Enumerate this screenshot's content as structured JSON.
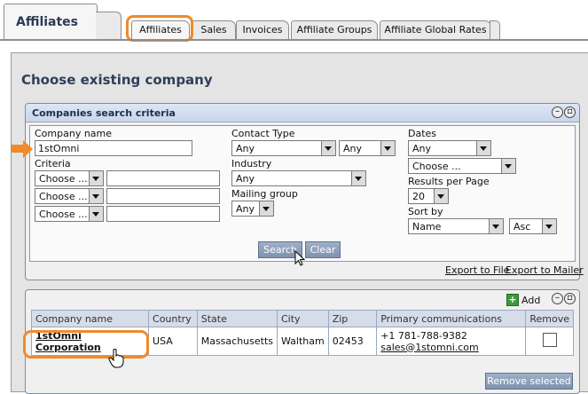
{
  "tabs": {
    "main": "Affiliates",
    "sub": [
      "Affiliates",
      "Sales",
      "Invoices",
      "Affiliate Groups",
      "Affiliate Global Rates"
    ]
  },
  "page_title": "Choose existing company",
  "search_panel": {
    "title": "Companies search criteria",
    "company_name_label": "Company name",
    "company_name_value": "1stOmni",
    "criteria_label": "Criteria",
    "criteria_select": "Choose ...",
    "contact_type_label": "Contact Type",
    "contact_type_value": "Any",
    "contact_type_value2": "Any",
    "industry_label": "Industry",
    "industry_value": "Any",
    "mailing_group_label": "Mailing group",
    "mailing_group_value": "Any",
    "dates_label": "Dates",
    "dates_value": "Any",
    "dates_choose": "Choose ...",
    "results_per_page_label": "Results per Page",
    "results_per_page_value": "20",
    "sort_by_label": "Sort by",
    "sort_by_value": "Name",
    "sort_order_value": "Asc",
    "search_button": "Search",
    "clear_button": "Clear",
    "export_file": "Export to File",
    "export_mailer": "Export to Mailer"
  },
  "results_panel": {
    "add_label": "Add",
    "columns": [
      "Company name",
      "Country",
      "State",
      "City",
      "Zip",
      "Primary communications",
      "Remove"
    ],
    "rows": [
      {
        "company": "1stOmni Corporation",
        "country": "USA",
        "state": "Massachusetts",
        "city": "Waltham",
        "zip": "02453",
        "phone": "+1 781-788-9382",
        "email": "sales@1stomni.com"
      }
    ],
    "remove_selected": "Remove selected"
  },
  "colors": {
    "highlight": "#f08a2c",
    "panel_head": "#c9d6ea",
    "button": "#8a9cb6"
  }
}
